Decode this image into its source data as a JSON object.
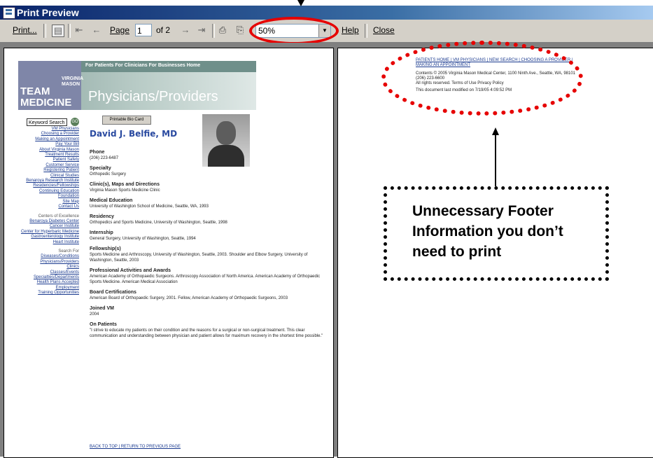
{
  "window": {
    "title": "Print Preview"
  },
  "toolbar": {
    "print_label": "Print...",
    "page_label": "Page",
    "page_value": "1",
    "of_label": "of 2",
    "zoom_value": "50%",
    "help_label": "Help",
    "close_label": "Close"
  },
  "page1": {
    "logo_line1": "TEAM",
    "logo_line2": "MEDICINE",
    "logo_small": "VIRGINIA MASON",
    "nav": "For Patients  For Clinicians  For Businesses   Home",
    "subtitle": "Physicians/Providers",
    "keyword": "Keyword Search",
    "go": "GO",
    "print_bio": "Printable Bio Card",
    "doctor": "David J. Belfie, MD",
    "left_nav": [
      "VM Physicians",
      "Choosing a Provider",
      "Making an Appointment",
      "Pay Your Bill",
      "About Virginia Mason",
      "Treatment Results",
      "Patient Safety",
      "Customer Service",
      "Registering Patient",
      "Clinical Studies",
      "Benaroya Research Institute",
      "Residencies/Fellowships",
      "Continuing Education",
      "Foundation",
      "Site Map",
      "Contact Us"
    ],
    "left_nav_heading1": "Centers of Excellence",
    "left_nav2": [
      "Benaroya Diabetes Center",
      "Cancer Institute",
      "Center for Hyperbaric Medicine",
      "Gastroenterology Institute",
      "Heart Institute"
    ],
    "left_nav_heading2": "Search For",
    "left_nav3": [
      "Diseases/Conditions",
      "Physicians/Providers",
      "Clinics",
      "Classes/Events",
      "Specialties/Departments",
      "Health Plans Accepted",
      "Employment",
      "Training Opportunities"
    ],
    "sections": [
      {
        "h": "Phone",
        "t": "(206) 223-6487"
      },
      {
        "h": "Specialty",
        "t": "Orthopedic Surgery"
      },
      {
        "h": "Clinic(s), Maps and Directions",
        "t": "Virginia Mason Sports Medicine Clinic"
      },
      {
        "h": "Medical Education",
        "t": "University of Washington School of Medicine, Seattle, WA, 1993"
      },
      {
        "h": "Residency",
        "t": "Orthopedics and Sports Medicine, University of Washington, Seattle, 1998"
      },
      {
        "h": "Internship",
        "t": "General Surgery, University of Washington, Seattle, 1994"
      },
      {
        "h": "Fellowship(s)",
        "t": "Sports Medicine and Arthroscopy, University of Washington, Seattle, 2003. Shoulder and Elbow Surgery, University of Washington, Seattle, 2003"
      },
      {
        "h": "Professional Activities and Awards",
        "t": "American Academy of Orthopaedic Surgeons. Arthroscopy Association of North America. American Academy of Orthopaedic Sports Medicine. American Medical Association"
      },
      {
        "h": "Board Certifications",
        "t": "American Board of Orthopaedic Surgery, 2001. Fellow, American Academy of Orthopaedic Surgeons, 2003"
      },
      {
        "h": "Joined VM",
        "t": "2004"
      },
      {
        "h": "On Patients",
        "t": "\"I strive to educate my patients on their condition and the reasons for a surgical or non-surgical treatment. This clear communication and understanding between physician and patient allows for maximum recovery in the shortest time possible.\""
      }
    ],
    "back_top": "BACK TO TOP | RETURN TO PREVIOUS PAGE"
  },
  "page2": {
    "links": "PATIENTS HOME | VM PHYSICIANS | NEW SEARCH | CHOOSING A PROVIDER | MAKING AN APPOINTMENT",
    "contact": "Contents © 2005 Virginia Mason Medical Center, 1100 Ninth Ave., Seattle, WA, 98101 (206) 223-6600",
    "rights": "All rights reserved.  Terms of Use  Privacy Policy",
    "modified": "This document last modified on 7/19/05 4:09:52 PM"
  },
  "annotation": {
    "callout": "Unnecessary Footer Information you don’t need to print"
  },
  "colors": {
    "highlight": "#e60000",
    "titlebar": "#0a246a",
    "toolbar": "#d4d0c8"
  }
}
